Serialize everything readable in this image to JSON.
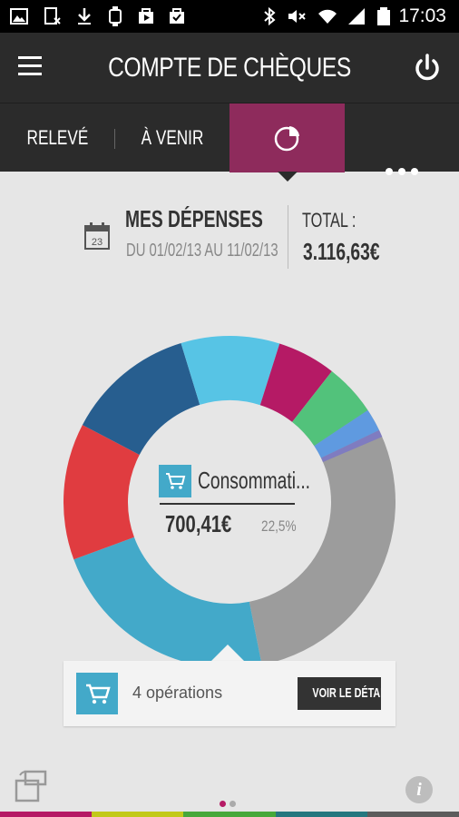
{
  "status_bar": {
    "time": "17:03"
  },
  "header": {
    "title": "COMPTE DE CHÈQUES"
  },
  "tabs": [
    {
      "label": "RELEVÉ"
    },
    {
      "label": "À VENIR"
    }
  ],
  "summary": {
    "title": "MES DÉPENSES",
    "calendar_day": "23",
    "date_range": "DU 01/02/13 AU 11/02/13",
    "total_label": "TOTAL :",
    "total_value": "3.116,63€"
  },
  "donut": {
    "center_category": "Consommati...",
    "center_amount": "700,41€",
    "center_percent": "22,5%",
    "segments": [
      {
        "color": "#9c9c9c",
        "percent": 34.1
      },
      {
        "color": "#43a9c9",
        "percent": 22.5
      },
      {
        "color": "#e03c40",
        "percent": 13.3
      },
      {
        "color": "#275e8f",
        "percent": 12.6
      },
      {
        "color": "#57c4e5",
        "percent": 9.6
      },
      {
        "color": "#b51a65",
        "percent": 5.7
      },
      {
        "color": "#52c27b",
        "percent": 5.1
      },
      {
        "color": "#5f9ae0",
        "percent": 2.2
      },
      {
        "color": "#7f7cc0",
        "percent": 0.7
      }
    ]
  },
  "detail": {
    "operations": "4 opérations",
    "button_label": "VOIR LE DÉTAIL"
  },
  "footer": {
    "info_glyph": "i",
    "page_dot_active": "#b51a65",
    "page_dot_inactive": "#aaaaaa",
    "strip_colors": [
      "#b51a65",
      "#c2c91a",
      "#47a83a",
      "#25777f",
      "#5c5c5c"
    ]
  },
  "colors": {
    "app_bar": "#2b2b2b",
    "active_tab": "#8e2b5c",
    "category_blue": "#43a9c9"
  }
}
